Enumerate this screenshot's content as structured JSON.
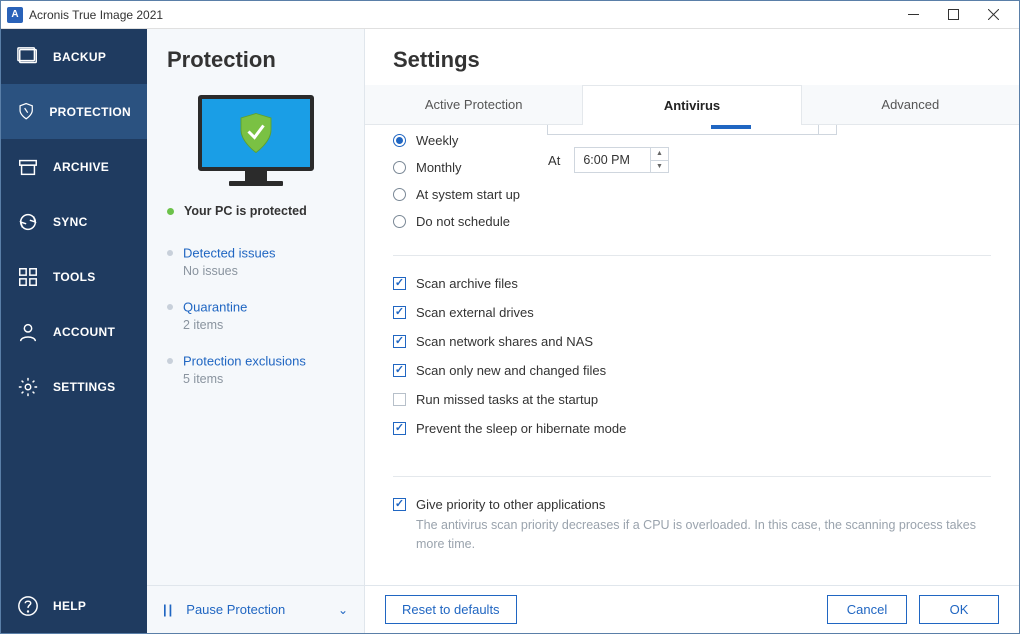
{
  "titlebar": {
    "title": "Acronis True Image 2021",
    "app_initial": "A"
  },
  "sidebar": {
    "items": [
      {
        "label": "BACKUP"
      },
      {
        "label": "PROTECTION"
      },
      {
        "label": "ARCHIVE"
      },
      {
        "label": "SYNC"
      },
      {
        "label": "TOOLS"
      },
      {
        "label": "ACCOUNT"
      },
      {
        "label": "SETTINGS"
      }
    ],
    "help": "HELP"
  },
  "secondary": {
    "title": "Protection",
    "status": "Your PC is protected",
    "items": [
      {
        "title": "Detected issues",
        "sub": "No issues"
      },
      {
        "title": "Quarantine",
        "sub": "2 items"
      },
      {
        "title": "Protection exclusions",
        "sub": "5 items"
      }
    ],
    "pause_label": "Pause Protection"
  },
  "settings": {
    "title": "Settings",
    "tabs": [
      {
        "label": "Active Protection"
      },
      {
        "label": "Antivirus"
      },
      {
        "label": "Advanced"
      }
    ],
    "schedule": {
      "options": [
        {
          "label": "Weekly",
          "selected": true
        },
        {
          "label": "Monthly",
          "selected": false
        },
        {
          "label": "At system start up",
          "selected": false
        },
        {
          "label": "Do not schedule",
          "selected": false
        }
      ],
      "at_label": "At",
      "time_value": "6:00 PM"
    },
    "scan_options": [
      {
        "label": "Scan archive files",
        "checked": true
      },
      {
        "label": "Scan external drives",
        "checked": true
      },
      {
        "label": "Scan network shares and NAS",
        "checked": true
      },
      {
        "label": "Scan only new and changed files",
        "checked": true
      },
      {
        "label": "Run missed tasks at the startup",
        "checked": false
      },
      {
        "label": "Prevent the sleep or hibernate mode",
        "checked": true
      }
    ],
    "priority": {
      "label": "Give priority to other applications",
      "checked": true,
      "desc": "The antivirus scan priority decreases if a CPU is overloaded. In this case, the scanning process takes more time."
    },
    "buttons": {
      "reset": "Reset to defaults",
      "cancel": "Cancel",
      "ok": "OK"
    }
  }
}
